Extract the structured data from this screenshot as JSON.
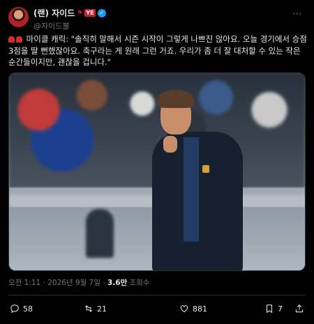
{
  "author": {
    "display_name": "(랜) 자이드",
    "badge_text": "YE",
    "handle": "@자이드불"
  },
  "tweet": {
    "text": "마이클 캐릭: \"솔직히 말해서 시즌 시작이 그렇게 나쁘진 않아요. 오늘 경기에서 승점 3점을 딸 뻔했잖아요. 축구라는 게 원래 그런 거죠. 우리가 좀 더 잘 대처할 수 있는 작은 순간들이지만, 괜찮을 겁니다.\""
  },
  "meta": {
    "timestamp": "오전 1:11 · 2026년 9월 7일 · ",
    "views_count": "3.6만",
    "views_label": " 조회수"
  },
  "actions": {
    "replies": "58",
    "retweets": "21",
    "likes": "881",
    "bookmarks": "7"
  },
  "colors": {
    "background": "#000000",
    "text": "#e7e9ea",
    "muted": "#71767b",
    "verified": "#1d9bf0"
  },
  "icons": [
    "siren-icon",
    "verified-icon",
    "more-icon",
    "reply-icon",
    "retweet-icon",
    "like-icon",
    "bookmark-icon",
    "share-icon"
  ]
}
